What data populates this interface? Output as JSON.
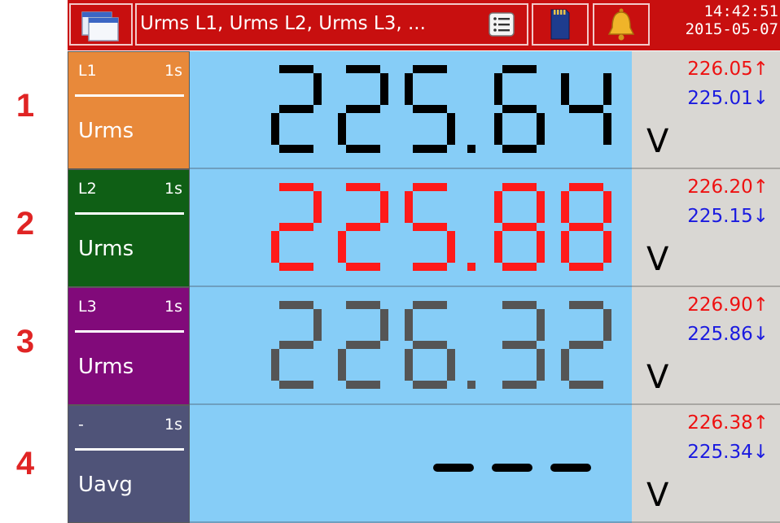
{
  "topbar": {
    "params_label": "Urms L1, Urms L2, Urms L3, ...",
    "time": "14:42:51",
    "date": "2015-05-07",
    "icons": [
      "windows-icon",
      "list-icon",
      "sd-card-icon",
      "bell-icon"
    ]
  },
  "rows": [
    {
      "number": "1",
      "channel": "L1",
      "interval": "1s",
      "quantity": "Urms",
      "value": "225.64",
      "max": "226.05↑",
      "min": "225.01↓",
      "unit": "V",
      "label_color": "#e8893a",
      "digit_color": "#000000"
    },
    {
      "number": "2",
      "channel": "L2",
      "interval": "1s",
      "quantity": "Urms",
      "value": "225.88",
      "max": "226.20↑",
      "min": "225.15↓",
      "unit": "V",
      "label_color": "#0f5f15",
      "digit_color": "#ff1a1a"
    },
    {
      "number": "3",
      "channel": "L3",
      "interval": "1s",
      "quantity": "Urms",
      "value": "226.32",
      "max": "226.90↑",
      "min": "225.86↓",
      "unit": "V",
      "label_color": "#810a7a",
      "digit_color": "#555555"
    },
    {
      "number": "4",
      "channel": "-",
      "interval": "1s",
      "quantity": "Uavg",
      "value": "---",
      "max": "226.38↑",
      "min": "225.34↓",
      "unit": "V",
      "label_color": "#4f5378",
      "digit_color": "#000000"
    }
  ]
}
